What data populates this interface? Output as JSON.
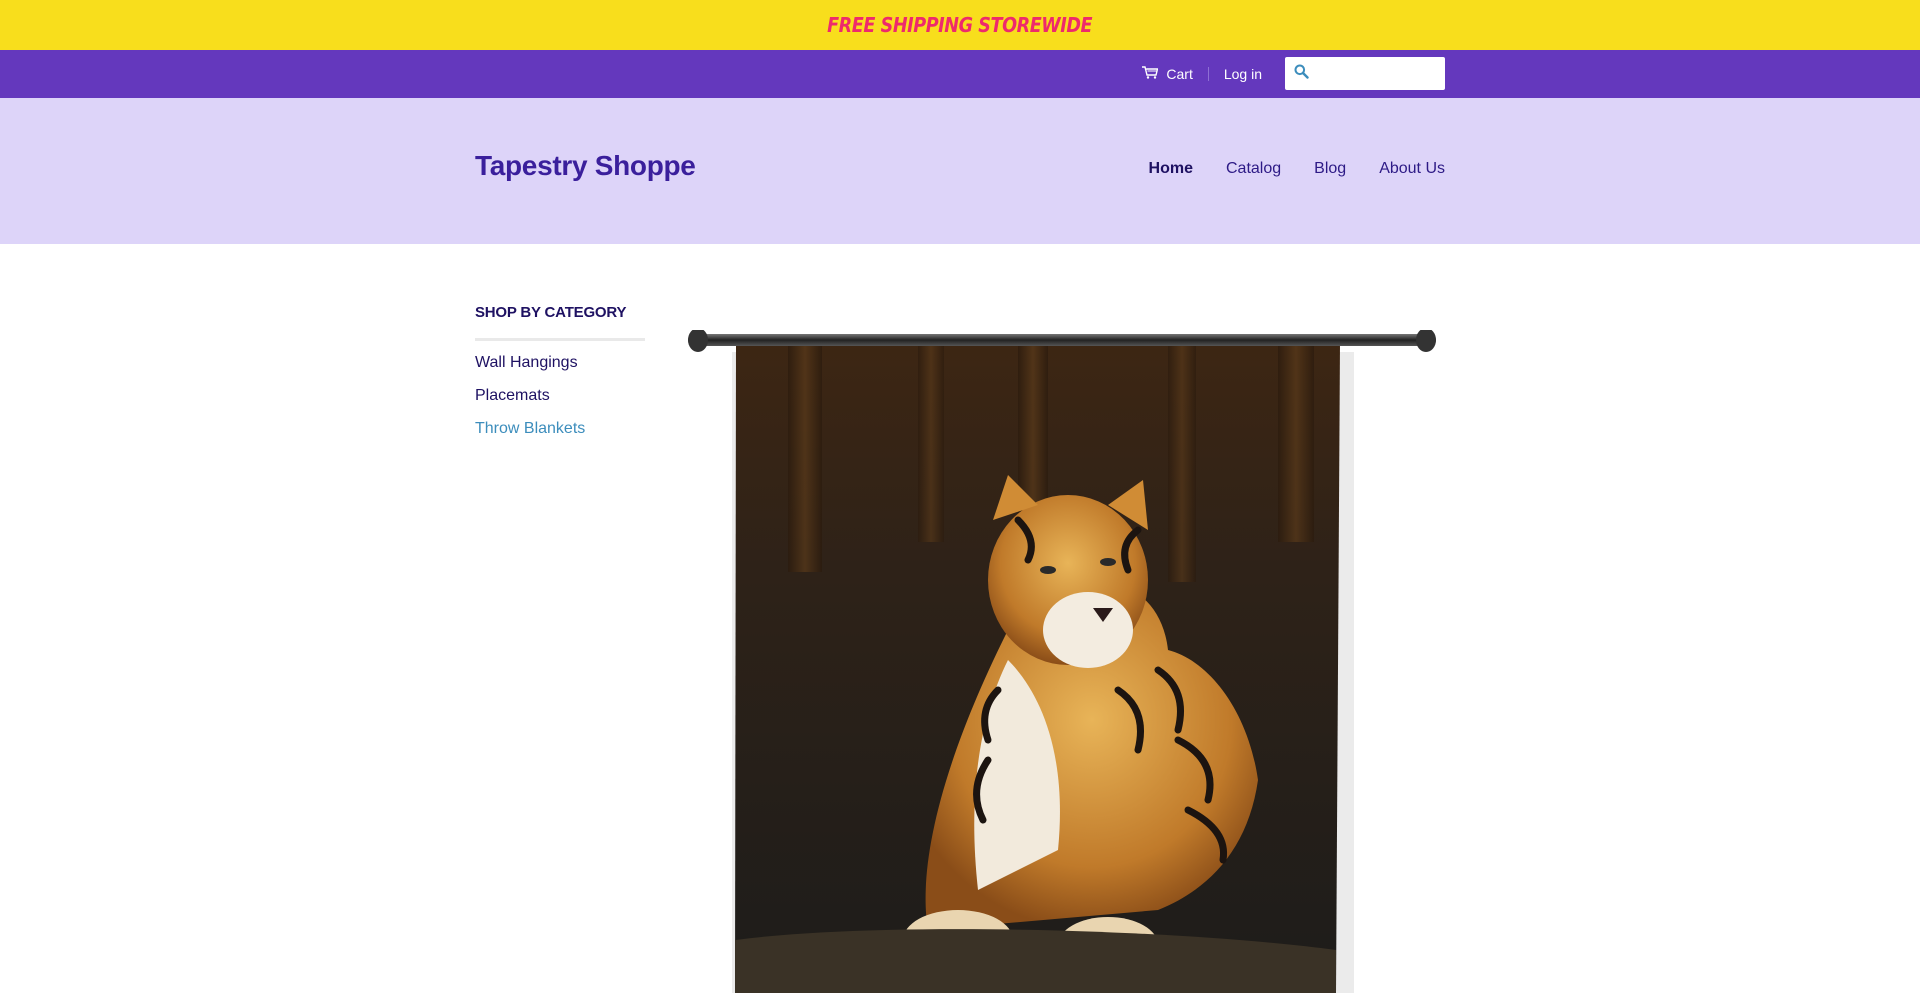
{
  "promo": {
    "text": "Free Shipping Storewide"
  },
  "topbar": {
    "cart_label": "Cart",
    "login_label": "Log in",
    "search_placeholder": ""
  },
  "header": {
    "logo": "Tapestry Shoppe",
    "nav": [
      {
        "label": "Home",
        "active": true
      },
      {
        "label": "Catalog"
      },
      {
        "label": "Blog"
      },
      {
        "label": "About Us"
      }
    ]
  },
  "sidebar": {
    "title": "SHOP BY CATEGORY",
    "items": [
      {
        "label": "Wall Hangings"
      },
      {
        "label": "Placemats"
      },
      {
        "label": "Throw Blankets"
      }
    ]
  },
  "colors": {
    "promo_bg": "#f8de1c",
    "promo_text": "#ee2a6c",
    "topbar_bg": "#6438bd",
    "header_bg": "#ddd4f9",
    "brand": "#3a1f9c",
    "link_accent": "#3c8dbc"
  },
  "icons": {
    "cart": "cart-icon",
    "search": "search-icon"
  }
}
